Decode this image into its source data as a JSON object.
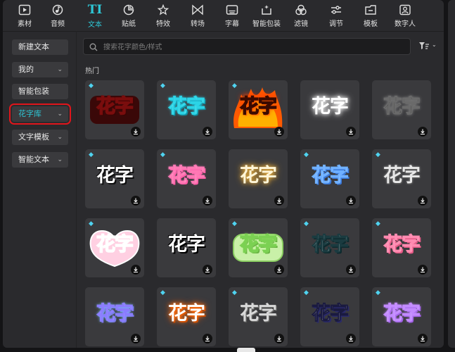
{
  "toolbar": {
    "items": [
      {
        "label": "素材",
        "icon": "media-icon"
      },
      {
        "label": "音频",
        "icon": "audio-icon"
      },
      {
        "label": "文本",
        "icon": "text-icon",
        "active": true
      },
      {
        "label": "贴纸",
        "icon": "sticker-icon"
      },
      {
        "label": "特效",
        "icon": "effects-icon"
      },
      {
        "label": "转场",
        "icon": "transition-icon"
      },
      {
        "label": "字幕",
        "icon": "subtitle-icon"
      },
      {
        "label": "智能包装",
        "icon": "smart-package-icon"
      },
      {
        "label": "滤镜",
        "icon": "filter-icon"
      },
      {
        "label": "调节",
        "icon": "adjust-icon"
      },
      {
        "label": "模板",
        "icon": "template-icon"
      },
      {
        "label": "数字人",
        "icon": "digital-human-icon"
      }
    ],
    "text_icon_glyph": "TI"
  },
  "sidebar": {
    "items": [
      {
        "label": "新建文本",
        "chevron": false
      },
      {
        "label": "我的",
        "chevron": true
      },
      {
        "label": "智能包装",
        "chevron": false
      },
      {
        "label": "花字库",
        "chevron": true,
        "active": true
      },
      {
        "label": "文字模板",
        "chevron": true
      },
      {
        "label": "智能文本",
        "chevron": true
      }
    ],
    "chevron_glyph": "⌄"
  },
  "search": {
    "placeholder": "搜索花字颜色/样式"
  },
  "section_title": "热门",
  "grid": {
    "sample_text": "花字",
    "cards": [
      {
        "premium": true
      },
      {
        "premium": true
      },
      {
        "premium": true
      },
      {
        "premium": false
      },
      {
        "premium": false
      },
      {
        "premium": true
      },
      {
        "premium": true
      },
      {
        "premium": false
      },
      {
        "premium": true
      },
      {
        "premium": true
      },
      {
        "premium": true
      },
      {
        "premium": false
      },
      {
        "premium": true
      },
      {
        "premium": true
      },
      {
        "premium": true
      },
      {
        "premium": false
      },
      {
        "premium": true
      },
      {
        "premium": true
      },
      {
        "premium": true
      },
      {
        "premium": true
      }
    ]
  },
  "colors": {
    "accent": "#2ec7d6",
    "highlight_border": "#e0151b",
    "premium_gem": "#4fd3f0"
  },
  "icons": {
    "gem": "◆",
    "download": "download-icon"
  }
}
